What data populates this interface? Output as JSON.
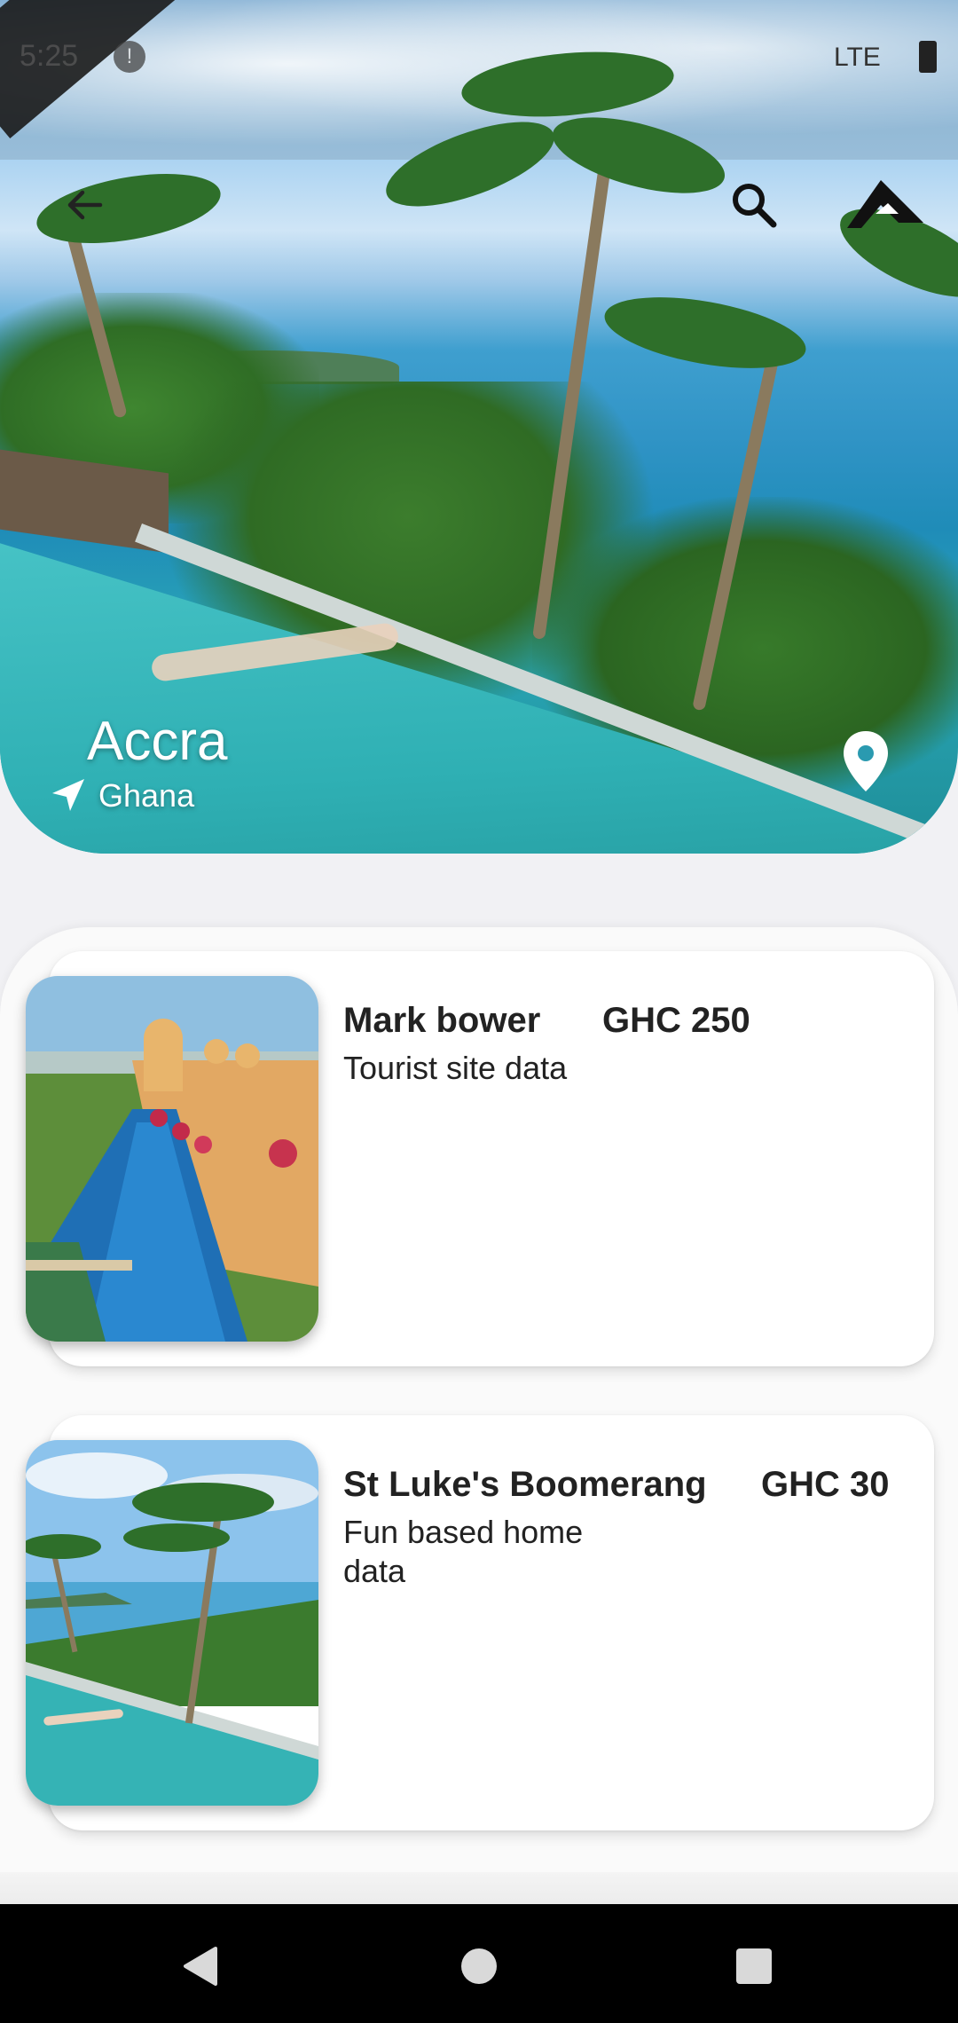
{
  "status_bar": {
    "time": "5:25",
    "alert": "!",
    "network": "LTE"
  },
  "header": {
    "back_icon": "arrow-back-icon",
    "search_icon": "search-icon",
    "brand_icon": "brand-logo-icon"
  },
  "hero": {
    "city": "Accra",
    "country": "Ghana",
    "location_icon": "navigation-arrow-icon",
    "pin_icon": "map-pin-icon"
  },
  "listings": [
    {
      "title": "Mark bower",
      "price": "GHC 250",
      "description": "Tourist site data"
    },
    {
      "title": "St Luke's Boomerang",
      "price": "GHC 30",
      "description": "Fun based home data"
    }
  ],
  "nav": {
    "back_icon": "triangle-back-icon",
    "home_icon": "circle-home-icon",
    "recent_icon": "square-recent-icon"
  },
  "colors": {
    "background": "#f1f1f4",
    "card": "#ffffff",
    "text": "#222222",
    "nav_bar": "#000000"
  }
}
